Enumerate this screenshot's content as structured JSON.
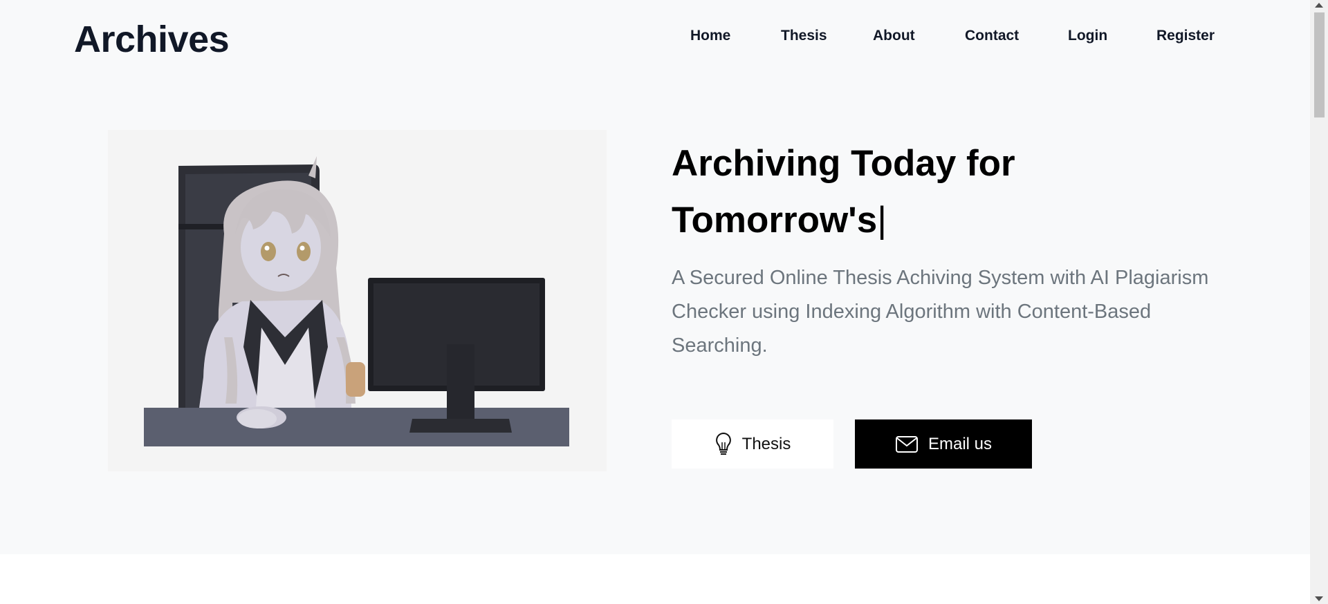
{
  "header": {
    "brand": "Archives",
    "nav": [
      {
        "label": "Home"
      },
      {
        "label": "Thesis"
      },
      {
        "label": "About"
      },
      {
        "label": "Contact"
      },
      {
        "label": "Login"
      },
      {
        "label": "Register"
      }
    ]
  },
  "hero": {
    "headline_line1": "Archiving Today for",
    "headline_line2": "Tomorrow's",
    "cursor": "|",
    "subtitle": "A Secured Online Thesis Achiving System with AI Plagiarism Checker using Indexing Algorithm with Content-Based Searching.",
    "buttons": {
      "thesis_label": "Thesis",
      "thesis_icon": "lightbulb-icon",
      "email_label": "Email us",
      "email_icon": "envelope-icon"
    },
    "illustration": "anime-girl-at-computer-illustration"
  },
  "colors": {
    "hero_bg": "#f8f9fa",
    "text_dark": "#111827",
    "subtitle": "#6c757d",
    "email_button_bg": "#000000"
  }
}
